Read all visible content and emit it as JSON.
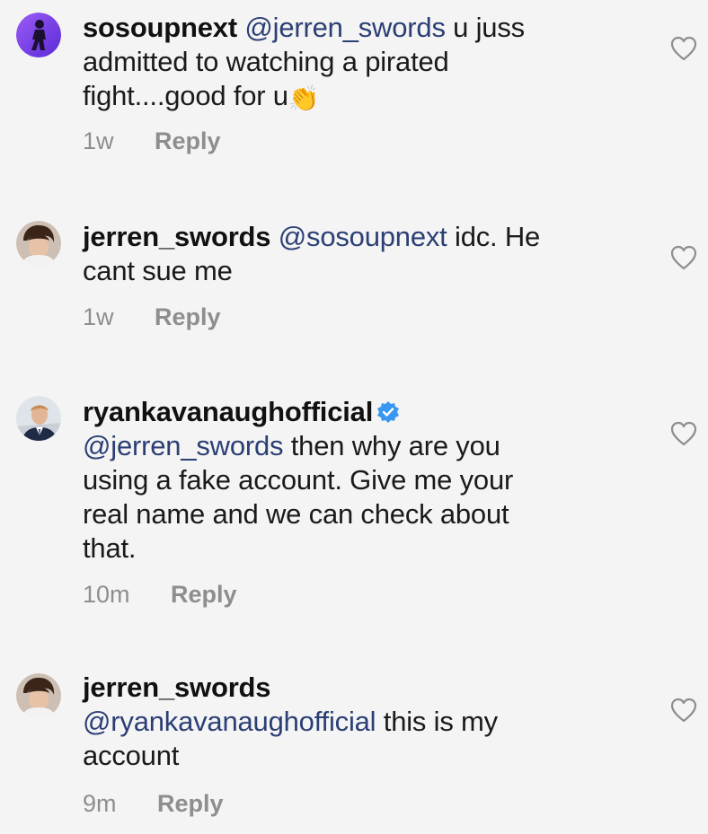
{
  "comments": [
    {
      "username": "sosoupnext",
      "mention": "@jerren_swords",
      "text_after_mention": " u juss",
      "line2": "admitted to watching a pirated",
      "line3": "fight....good for u",
      "emoji": "👏",
      "time": "1w",
      "reply_label": "Reply",
      "avatar_icon": "person-silhouette-purple-avatar",
      "avatar_color": "#7b3fe4"
    },
    {
      "username": "jerren_swords",
      "mention": "@sosoupnext",
      "text_after_mention": " idc. He",
      "line2": "cant sue me",
      "time": "1w",
      "reply_label": "Reply",
      "avatar_icon": "curly-hair-person-avatar"
    },
    {
      "username": "ryankavanaughofficial",
      "verified": true,
      "mention": "@jerren_swords",
      "text_after_mention": " then why are you",
      "line3": "using a fake account. Give me your",
      "line4": "real name and we can check about",
      "line5": "that.",
      "time": "10m",
      "reply_label": "Reply",
      "avatar_icon": "man-in-suit-avatar"
    },
    {
      "username": "jerren_swords",
      "mention": "@ryankavanaughofficial",
      "text_after_mention": " this is my",
      "line3": "account",
      "time": "9m",
      "reply_label": "Reply",
      "avatar_icon": "curly-hair-person-avatar"
    }
  ],
  "colors": {
    "background": "#f4f4f4",
    "mention": "#2c3f75",
    "meta_gray": "#8e8e8e",
    "verified_blue": "#3897f0"
  },
  "icons": {
    "like": "heart-outline-icon",
    "verified": "verified-badge-icon"
  }
}
